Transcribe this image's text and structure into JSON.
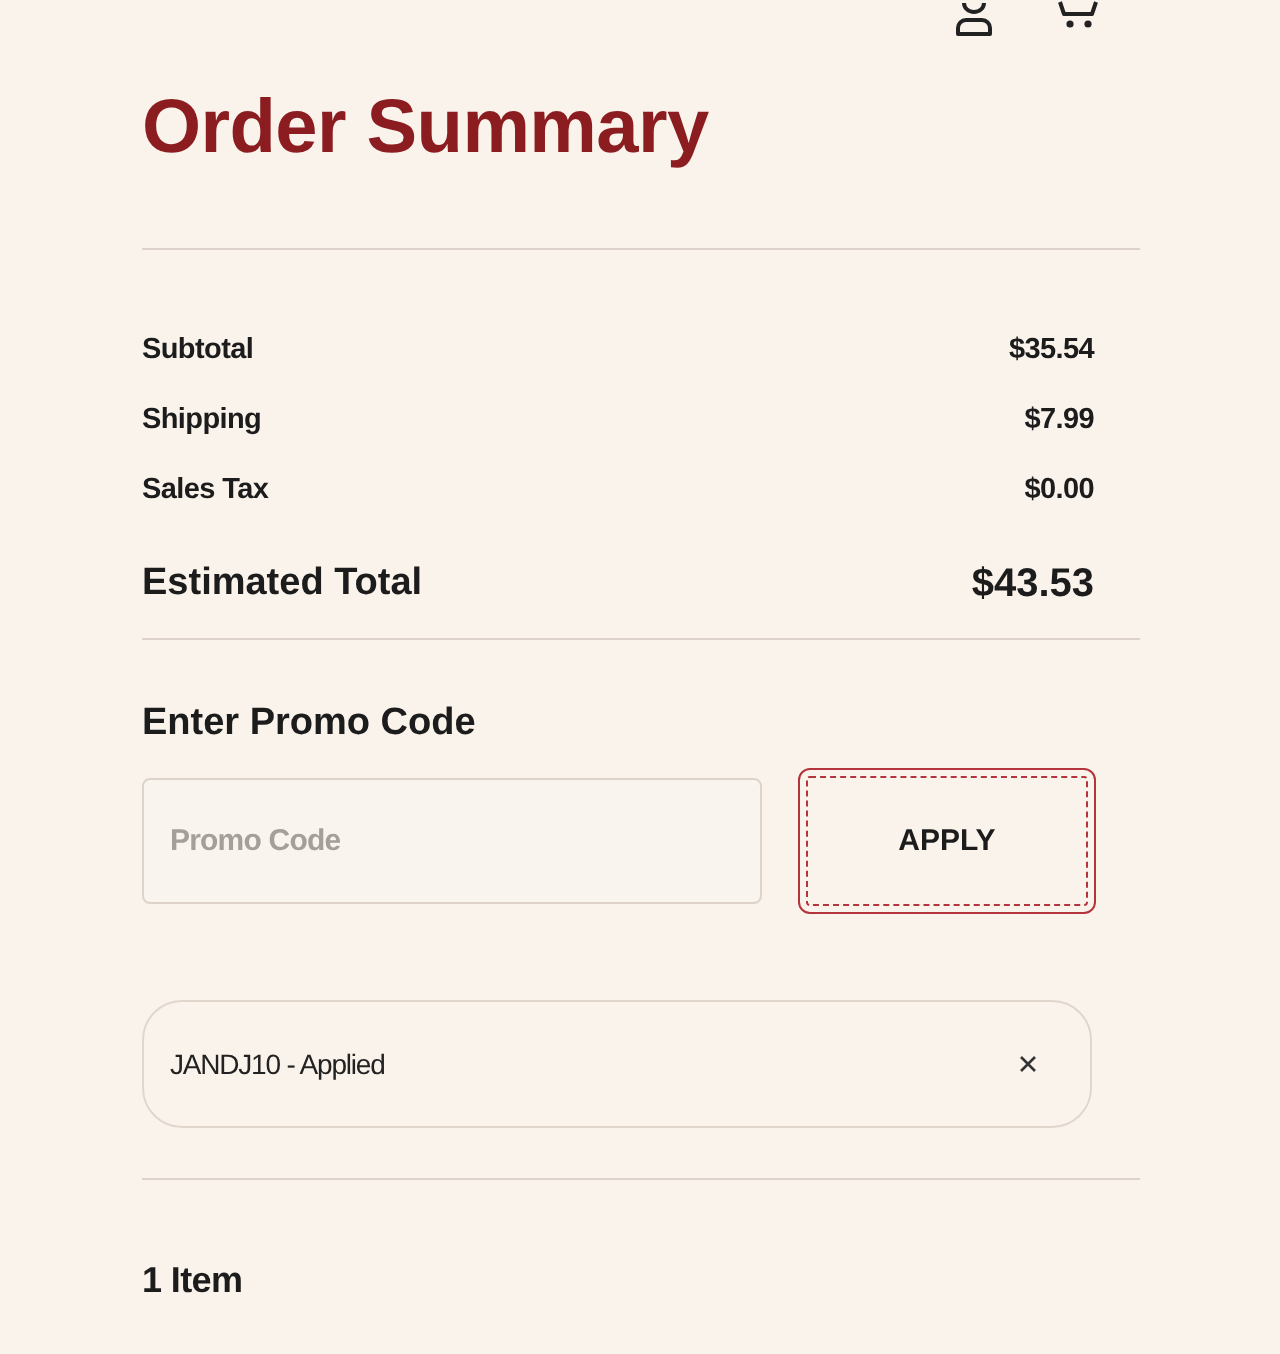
{
  "title": "Order Summary",
  "summary": {
    "lines": [
      {
        "label": "Subtotal",
        "value": "$35.54"
      },
      {
        "label": "Shipping",
        "value": "$7.99"
      },
      {
        "label": "Sales Tax",
        "value": "$0.00"
      }
    ],
    "total": {
      "label": "Estimated Total",
      "value": "$43.53"
    }
  },
  "promo": {
    "heading": "Enter Promo Code",
    "field": {
      "placeholder": "Promo Code"
    },
    "apply_button": {
      "label": "APPLY",
      "focused": true
    },
    "applied_codes": [
      {
        "text": "JANDJ10 - Applied"
      }
    ]
  },
  "items_heading": "1 Item"
}
